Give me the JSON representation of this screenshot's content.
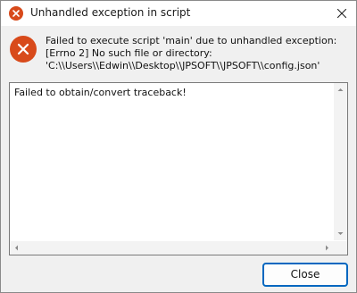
{
  "window": {
    "title": "Unhandled exception in script",
    "title_icon": "error-icon",
    "close_icon": "close-icon"
  },
  "message": {
    "icon": "error-icon",
    "line1": "Failed to execute script 'main' due to unhandled exception:",
    "line2": "[Errno 2] No such file or directory:",
    "line3": "'C:\\\\Users\\\\Edwin\\\\Desktop\\\\JPSOFT\\\\JPSOFT\\\\config.json'"
  },
  "traceback": {
    "text": "Failed to obtain/convert traceback!"
  },
  "buttons": {
    "close_label": "Close"
  },
  "colors": {
    "accent": "#0067c0",
    "error": "#d84a1b"
  }
}
